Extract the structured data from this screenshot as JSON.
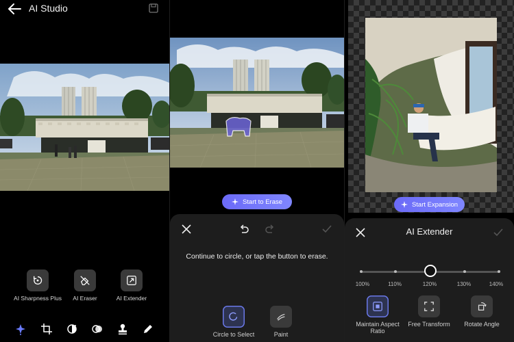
{
  "panel1": {
    "title": "AI Studio",
    "tools": [
      {
        "label": "AI Sharpness Plus",
        "icon": "sharpness-icon"
      },
      {
        "label": "AI Eraser",
        "icon": "eraser-icon"
      },
      {
        "label": "AI Extender",
        "icon": "extender-icon"
      }
    ],
    "nav_icons": [
      "ai-sparkle-icon",
      "crop-icon",
      "adjust-icon",
      "filter-icon",
      "stamp-icon",
      "pen-icon"
    ],
    "accent": "#6b7cff"
  },
  "panel2": {
    "start_button": "Start to Erase",
    "message": "Continue to circle, or tap the button to erase.",
    "modes": [
      {
        "label": "Circle to Select",
        "selected": true
      },
      {
        "label": "Paint",
        "selected": false
      }
    ]
  },
  "panel3": {
    "start_button": "Start Expansion",
    "sheet_title": "AI Extender",
    "slider": {
      "ticks": [
        "100%",
        "110%",
        "120%",
        "130%",
        "140%"
      ],
      "value": "120%"
    },
    "options": [
      {
        "label": "Maintain Aspect Ratio",
        "selected": true
      },
      {
        "label": "Free Transform",
        "selected": false
      },
      {
        "label": "Rotate Angle",
        "selected": false
      }
    ]
  }
}
